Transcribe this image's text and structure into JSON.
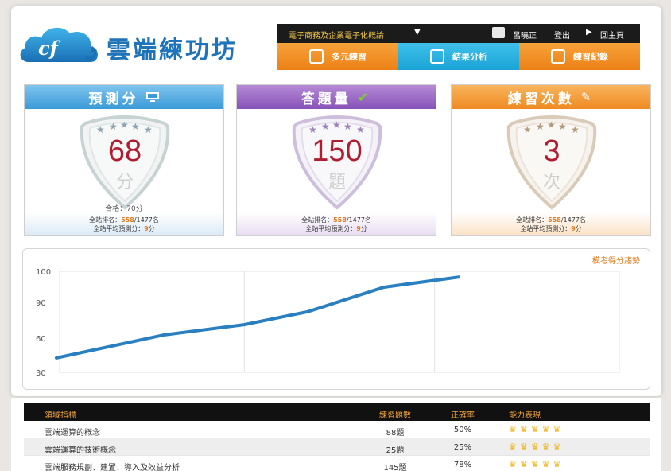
{
  "brand": {
    "name": "雲端練功坊",
    "logo_letters": "cf"
  },
  "nav": {
    "course": "電子商務及企業電子化概論",
    "user": "呂曉正",
    "logout": "登出",
    "home": "回主頁",
    "tabs": [
      {
        "label": "多元練習",
        "icon": "calendar-icon",
        "color": "orange"
      },
      {
        "label": "結果分析",
        "icon": "analysis-icon",
        "color": "blue"
      },
      {
        "label": "練習紀錄",
        "icon": "edit-record-icon",
        "color": "orange"
      }
    ]
  },
  "cards": [
    {
      "title": "預測分",
      "title_icon": "monitor-icon",
      "value": "68",
      "unit": "分",
      "pass": "合格：70分",
      "rank_label": "全站排名：",
      "rank": "558",
      "rank_total": "/1477名",
      "avg_label": "全站平均預測分：",
      "avg": "9",
      "avg_unit": "分"
    },
    {
      "title": "答題量",
      "title_icon": "check-icon",
      "value": "150",
      "unit": "題",
      "rank_label": "全站排名：",
      "rank": "558",
      "rank_total": "/1477名",
      "avg_label": "全站平均預測分：",
      "avg": "9",
      "avg_unit": "分"
    },
    {
      "title": "練習次數",
      "title_icon": "pencil-icon",
      "value": "3",
      "unit": "次",
      "rank_label": "全站排名：",
      "rank": "558",
      "rank_total": "/1477名",
      "avg_label": "全站平均預測分：",
      "avg": "9",
      "avg_unit": "分"
    }
  ],
  "chart_data": {
    "type": "line",
    "title": "模考得分趨勢",
    "y_ticks": [
      "100",
      "90",
      "60",
      "30"
    ],
    "values": [
      40,
      56,
      63,
      72,
      89,
      96
    ],
    "line_color": "#2a7fc1",
    "grid": true
  },
  "table": {
    "headers": [
      "領域指標",
      "練習題數",
      "正確率",
      "能力表現"
    ],
    "rows": [
      {
        "name": "雲端運算的概念",
        "count": "88題",
        "rate": "50%",
        "crowns": 5
      },
      {
        "name": "雲端運算的技術概念",
        "count": "25題",
        "rate": "25%",
        "crowns": 5
      },
      {
        "name": "雲端服務規劃、建置、導入及效益分析",
        "count": "145題",
        "rate": "78%",
        "crowns": 5
      }
    ]
  }
}
